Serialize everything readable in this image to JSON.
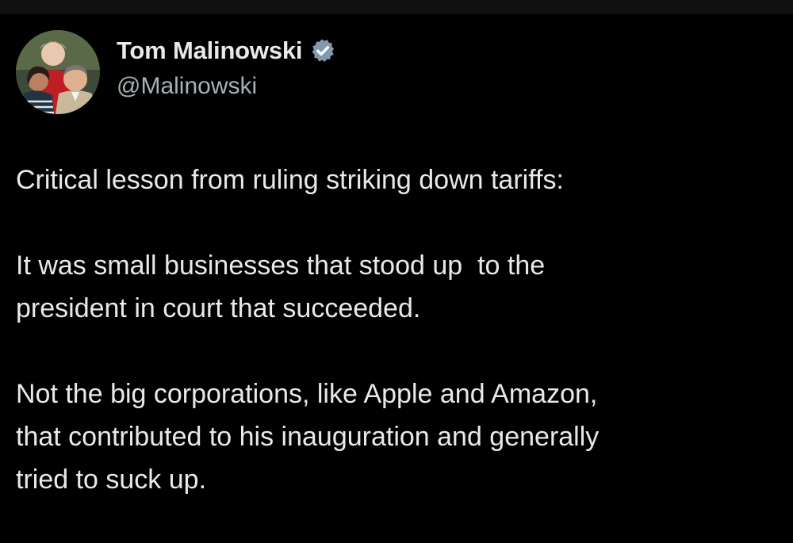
{
  "author": {
    "display_name": "Tom Malinowski",
    "handle": "@Malinowski",
    "verified_icon": "verified-badge-icon",
    "avatar": "profile-photo-avatar"
  },
  "tweet": {
    "paragraphs": [
      "Critical lesson from ruling striking down tariffs:",
      "It was small businesses that stood up  to the\npresident in court that succeeded.",
      "Not the big corporations, like Apple and Amazon,\nthat contributed to his inauguration and generally\ntried to suck up."
    ]
  },
  "colors": {
    "background": "#000000",
    "text": "#e7e9ea",
    "secondary_text": "#a8b0b6",
    "verified_badge": "#829aab"
  }
}
